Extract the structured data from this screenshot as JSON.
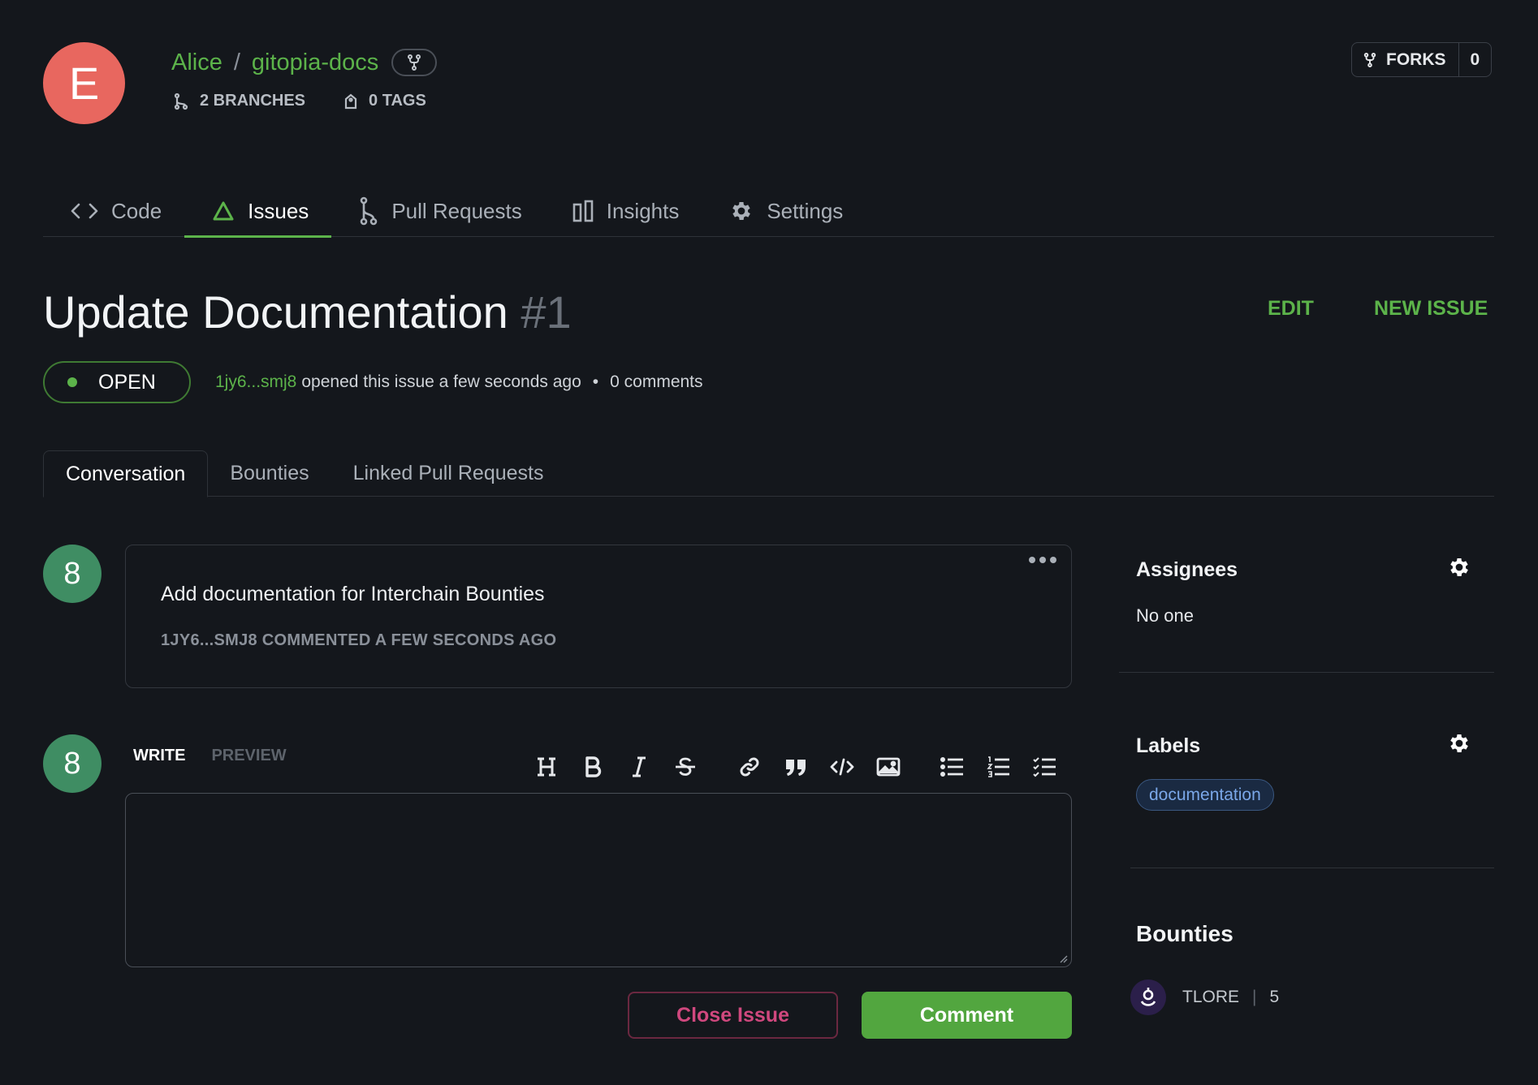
{
  "repo": {
    "avatar_letter": "E",
    "owner": "Alice",
    "separator": "/",
    "name": "gitopia-docs",
    "branches_label": "2 BRANCHES",
    "tags_label": "0 TAGS",
    "forks_label": "FORKS",
    "forks_count": "0"
  },
  "nav": {
    "tabs": [
      {
        "label": "Code",
        "icon": "code-icon"
      },
      {
        "label": "Issues",
        "icon": "issue-triangle-icon",
        "active": true
      },
      {
        "label": "Pull Requests",
        "icon": "pull-request-icon"
      },
      {
        "label": "Insights",
        "icon": "insights-icon"
      },
      {
        "label": "Settings",
        "icon": "gear-icon"
      }
    ]
  },
  "issue": {
    "title": "Update Documentation",
    "number": "#1",
    "edit_label": "EDIT",
    "new_issue_label": "NEW ISSUE",
    "status": "OPEN",
    "author": "1jy6...smj8",
    "opened_text": "opened this issue a few seconds ago",
    "bullet": "•",
    "comments_text": "0 comments"
  },
  "subtabs": [
    "Conversation",
    "Bounties",
    "Linked Pull Requests"
  ],
  "comment": {
    "avatar_letter": "8",
    "body": "Add documentation for Interchain Bounties",
    "meta": "1JY6...SMJ8 COMMENTED A FEW SECONDS AGO"
  },
  "editor": {
    "avatar_letter": "8",
    "write_label": "WRITE",
    "preview_label": "PREVIEW",
    "textarea_value": "",
    "close_label": "Close Issue",
    "comment_label": "Comment"
  },
  "sidebar": {
    "assignees_title": "Assignees",
    "assignees_value": "No one",
    "labels_title": "Labels",
    "labels": [
      "documentation"
    ],
    "bounties_title": "Bounties",
    "bounty_token": "TLORE",
    "bounty_sep": "|",
    "bounty_amount": "5"
  },
  "colors": {
    "background": "#14171c",
    "accent_green": "#5cb34a",
    "avatar_red": "#e8675f",
    "avatar_green": "#3f8d63",
    "close_pink": "#d0487e",
    "label_blue": "#7aa7e8"
  }
}
